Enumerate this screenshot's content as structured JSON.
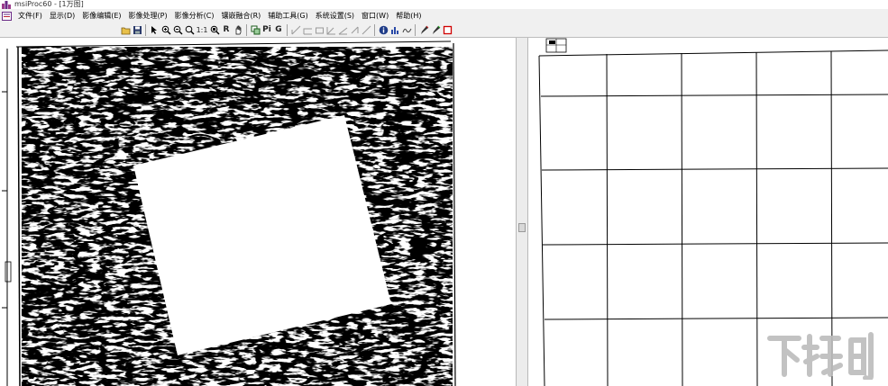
{
  "titlebar": {
    "title": "msiProc60 - [1万图]"
  },
  "menubar": {
    "items": [
      {
        "label": "文件(F)"
      },
      {
        "label": "显示(D)"
      },
      {
        "label": "影像编辑(E)"
      },
      {
        "label": "影像处理(P)"
      },
      {
        "label": "影像分析(C)"
      },
      {
        "label": "镶嵌融合(R)"
      },
      {
        "label": "辅助工具(G)"
      },
      {
        "label": "系统设置(S)"
      },
      {
        "label": "窗口(W)"
      },
      {
        "label": "帮助(H)"
      }
    ]
  },
  "toolbar": {
    "zoom_one_label": "1:1",
    "r_label": "R",
    "p_label": "Pi",
    "g_label": "G"
  },
  "colors": {
    "title_icon": "#9c3b8c",
    "grid_line": "#000000",
    "toolbar_bg": "#f0f0f0",
    "stop_square": "#d00000",
    "info_icon": "#1f3c88"
  },
  "watermark": {
    "text": "下载吧",
    "color": "#bcbcbc"
  }
}
